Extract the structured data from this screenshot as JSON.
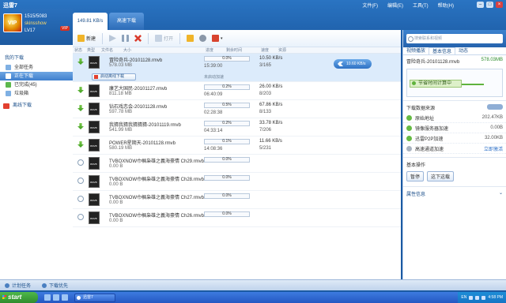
{
  "window": {
    "title": "迅雷7"
  },
  "menus": [
    "文件(F)",
    "编辑(E)",
    "工具(T)",
    "帮助(H)"
  ],
  "user": {
    "id": "1515/5083",
    "nickname": "skinsshow",
    "level": "LV17",
    "badge": "VIP",
    "avatar_text": "VIP"
  },
  "nav": {
    "group_label": "我的下载",
    "items": [
      {
        "label": "全部任务"
      },
      {
        "label": "正在下载"
      },
      {
        "label": "已完成(45)"
      },
      {
        "label": "垃圾箱"
      }
    ],
    "vip_download": "离线下载"
  },
  "tabs": [
    "149.81 KB/s",
    "高速下载"
  ],
  "toolbar": {
    "new": "新建",
    "play": "",
    "pause": "",
    "delete": "",
    "open": "打开",
    "folder": "",
    "settings": "",
    "more": ""
  },
  "columns": [
    "状态",
    "类型",
    "文件名",
    "大小",
    "进度",
    "剩余时间",
    "速度",
    "资源"
  ],
  "rows": [
    {
      "status": "down",
      "name": "冒险奇兵-20101128.rmvb",
      "size": "578.03 MB",
      "progress": 0.0,
      "pct": "0.0%",
      "time": "15:39:00",
      "speed": "10.50 KB/s",
      "peers": "3/165",
      "selected": true,
      "vip_label": "启动离线下载",
      "accel": "未启动加速",
      "pill": "10.60 KB/s"
    },
    {
      "status": "down",
      "name": "康艺大国民-20101127.rmvb",
      "size": "811.18 MB",
      "progress": 0.2,
      "pct": "0.2%",
      "time": "06:40:09",
      "speed": "26.00 KB/s",
      "peers": "8/203"
    },
    {
      "status": "down",
      "name": "钻石戏恋会-20101128.rmvb",
      "size": "597.78 MB",
      "progress": 0.5,
      "pct": "0.5%",
      "time": "02:28:38",
      "speed": "67.86 KB/s",
      "peers": "8/133"
    },
    {
      "status": "down",
      "name": "我猜我猜我猜猜猜-20101119.rmvb",
      "size": "541.99 MB",
      "progress": 0.2,
      "pct": "0.2%",
      "time": "04:33:14",
      "speed": "33.78 KB/s",
      "peers": "7/206"
    },
    {
      "status": "down",
      "name": "POWER星期天-20101128.rmvb",
      "size": "580.19 MB",
      "progress": 0.1,
      "pct": "0.1%",
      "time": "14:08:36",
      "speed": "11.66 KB/s",
      "peers": "5/231"
    },
    {
      "status": "wait",
      "name": "TVBOXNOW巾帼枭雄之義海豪情 Ch29.rmvb",
      "size": "0.00 B",
      "progress": 0.0,
      "pct": "0.0%",
      "time": "",
      "speed": "",
      "peers": ""
    },
    {
      "status": "wait",
      "name": "TVBOXNOW巾帼枭雄之義海豪情 Ch28.rmvb",
      "size": "0.00 B",
      "progress": 0.0,
      "pct": "0.0%",
      "time": "",
      "speed": "",
      "peers": ""
    },
    {
      "status": "wait",
      "name": "TVBOXNOW巾帼枭雄之義海豪情 Ch27.rmvb",
      "size": "0.00 B",
      "progress": 0.0,
      "pct": "0.0%",
      "time": "",
      "speed": "",
      "peers": ""
    },
    {
      "status": "wait",
      "name": "TVBOXNOW巾帼枭雄之義海豪情 Ch26.rmvb",
      "size": "0.00 B",
      "progress": 0.0,
      "pct": "0.0%",
      "time": "",
      "speed": "",
      "peers": ""
    }
  ],
  "right": {
    "search_placeholder": "搜索联系和视频",
    "tabs": [
      "视频播放",
      "基本信息",
      "动态"
    ],
    "file_name": "冒险奇兵-20101128.rmvb",
    "file_size": "578.03MB",
    "plan_label": "节省时间计算中",
    "sources_title": "下载数据来源",
    "sources": [
      {
        "label": "原始地址",
        "value": "202.47KB",
        "state": "on"
      },
      {
        "label": "镜像服务器加速",
        "value": "0.00B",
        "state": "on"
      },
      {
        "label": "迅雷P2P加速",
        "value": "32.00KB",
        "state": "on"
      },
      {
        "label": "高速通道加速",
        "value": "立即激活",
        "state": "off"
      }
    ],
    "ops_title": "基本操作",
    "ops": [
      "暂停",
      "这下这载"
    ],
    "attr_title": "属性信息"
  },
  "bottom": {
    "plan": "计划任务",
    "speed_limit": "下载优先"
  },
  "taskbar": {
    "start": "start",
    "task": "迅雷7",
    "lang": "EN",
    "clock": "4:58 PM"
  },
  "colors": {
    "accent": "#2c6cb8",
    "progress": "#59a83b",
    "close": "#d94141"
  }
}
